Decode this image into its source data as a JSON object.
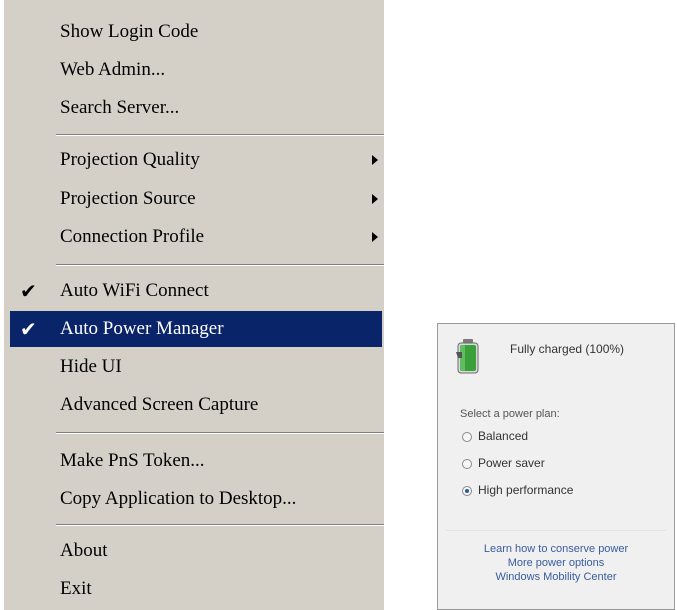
{
  "context_menu": {
    "items": [
      {
        "label": "Show Login Code"
      },
      {
        "label": "Web Admin..."
      },
      {
        "label": "Search Server..."
      },
      {
        "label": "Projection Quality",
        "submenu": true
      },
      {
        "label": "Projection Source",
        "submenu": true
      },
      {
        "label": "Connection Profile",
        "submenu": true
      },
      {
        "label": "Auto WiFi Connect",
        "checked": true
      },
      {
        "label": "Auto Power Manager",
        "checked": true,
        "highlighted": true
      },
      {
        "label": "Hide UI"
      },
      {
        "label": "Advanced Screen Capture"
      },
      {
        "label": "Make PnS Token..."
      },
      {
        "label": "Copy Application to Desktop..."
      },
      {
        "label": "About"
      },
      {
        "label": "Exit"
      }
    ],
    "check_glyph": "✔",
    "highlight_color": "#0a246a"
  },
  "power_flyout": {
    "status": "Fully charged (100%)",
    "select_plan_label": "Select a power plan:",
    "plans": [
      {
        "label": "Balanced",
        "selected": false
      },
      {
        "label": "Power saver",
        "selected": false
      },
      {
        "label": "High performance",
        "selected": true
      }
    ],
    "links": [
      "Learn how to conserve power",
      "More power options",
      "Windows Mobility Center"
    ],
    "battery_level": 1.0,
    "battery_color": "#3aa03a"
  }
}
